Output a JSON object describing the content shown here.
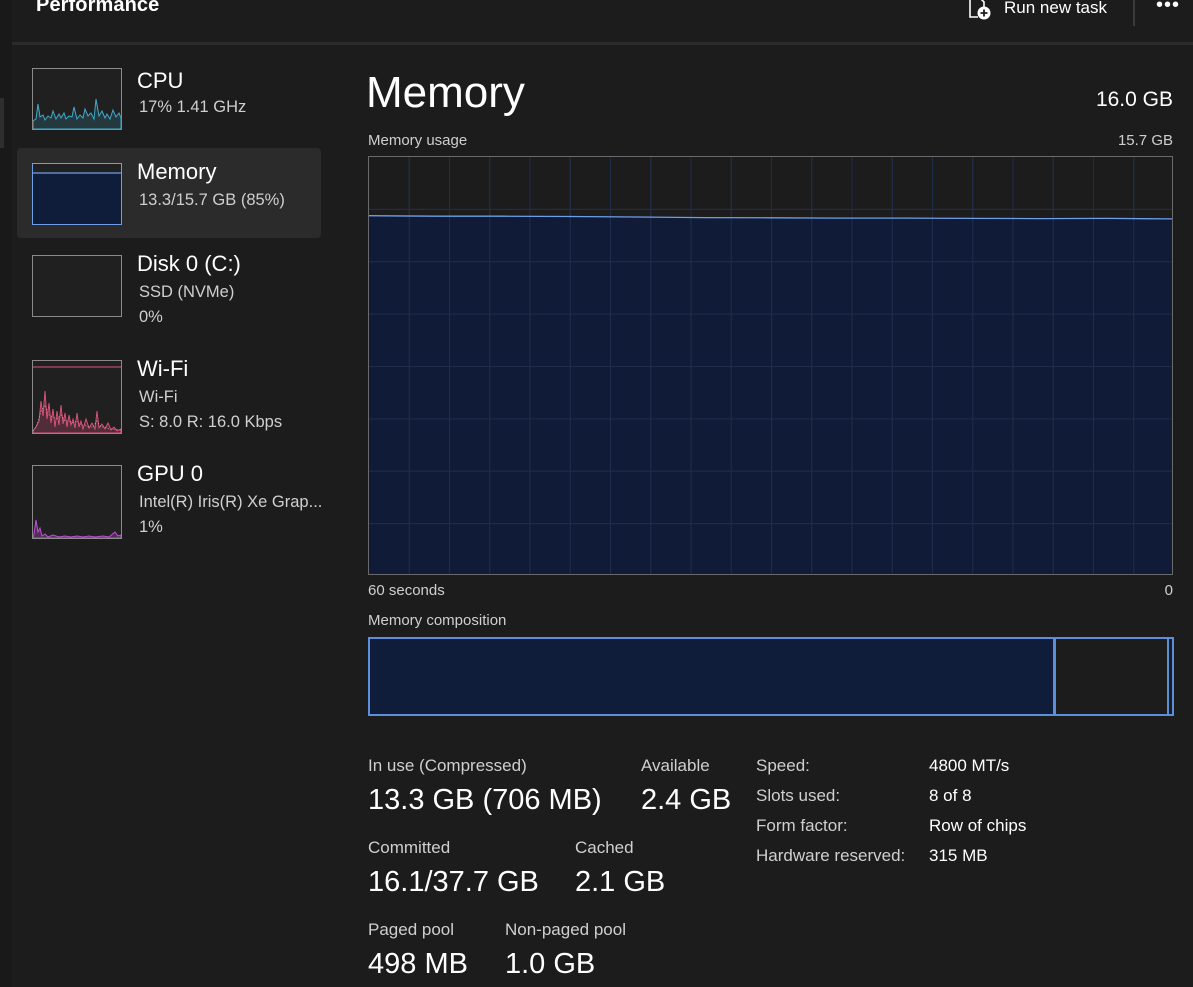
{
  "header": {
    "title": "Performance",
    "run_new_task_label": "Run new task",
    "run_new_task_icon": "run-task-icon",
    "more_icon": "more-icon",
    "more_glyph": "•••"
  },
  "sidebar": {
    "items": [
      {
        "name": "CPU",
        "line1": "17%  1.41 GHz",
        "line2": "",
        "accent": "#3fa9c9",
        "selected": false
      },
      {
        "name": "Memory",
        "line1": "13.3/15.7 GB (85%)",
        "line2": "",
        "accent": "#6f9ee8",
        "selected": true
      },
      {
        "name": "Disk 0 (C:)",
        "line1": "SSD (NVMe)",
        "line2": "0%",
        "accent": "#9acd32",
        "selected": false
      },
      {
        "name": "Wi-Fi",
        "line1": "Wi-Fi",
        "line2": "S: 8.0  R: 16.0 Kbps",
        "accent": "#e0557f",
        "selected": false
      },
      {
        "name": "GPU 0",
        "line1": "Intel(R) Iris(R) Xe Grap...",
        "line2": "1%",
        "accent": "#c04fd6",
        "selected": false
      }
    ]
  },
  "main": {
    "title": "Memory",
    "total": "16.0 GB",
    "usage_label": "Memory usage",
    "usage_max": "15.7 GB",
    "time_left": "60 seconds",
    "time_right": "0",
    "composition_label": "Memory composition",
    "composition": {
      "in_use_fraction": 0.855,
      "modified_fraction": 0.996
    },
    "stats": {
      "in_use_label": "In use (Compressed)",
      "in_use_value": "13.3 GB (706 MB)",
      "available_label": "Available",
      "available_value": "2.4 GB",
      "committed_label": "Committed",
      "committed_value": "16.1/37.7 GB",
      "cached_label": "Cached",
      "cached_value": "2.1 GB",
      "paged_label": "Paged pool",
      "paged_value": "498 MB",
      "nonpaged_label": "Non-paged pool",
      "nonpaged_value": "1.0 GB"
    },
    "properties": {
      "speed_label": "Speed:",
      "speed_value": "4800 MT/s",
      "slots_label": "Slots used:",
      "slots_value": "8 of 8",
      "form_label": "Form factor:",
      "form_value": "Row of chips",
      "hw_label": "Hardware reserved:",
      "hw_value": "315 MB"
    }
  },
  "colors": {
    "memory_fill": "#0f1c3a",
    "memory_line": "#6f9ee8",
    "grid": "#2f3a4f"
  },
  "chart_data": {
    "type": "area",
    "title": "Memory usage",
    "xlabel": "",
    "ylabel": "",
    "x_range_label": [
      "60 seconds",
      "0"
    ],
    "ylim": [
      0,
      15.7
    ],
    "x": [
      60,
      55,
      50,
      45,
      40,
      35,
      30,
      25,
      20,
      15,
      10,
      5,
      0
    ],
    "series": [
      {
        "values": [
          13.5,
          13.48,
          13.48,
          13.47,
          13.45,
          13.43,
          13.42,
          13.41,
          13.41,
          13.4,
          13.39,
          13.4,
          13.38
        ]
      }
    ]
  }
}
